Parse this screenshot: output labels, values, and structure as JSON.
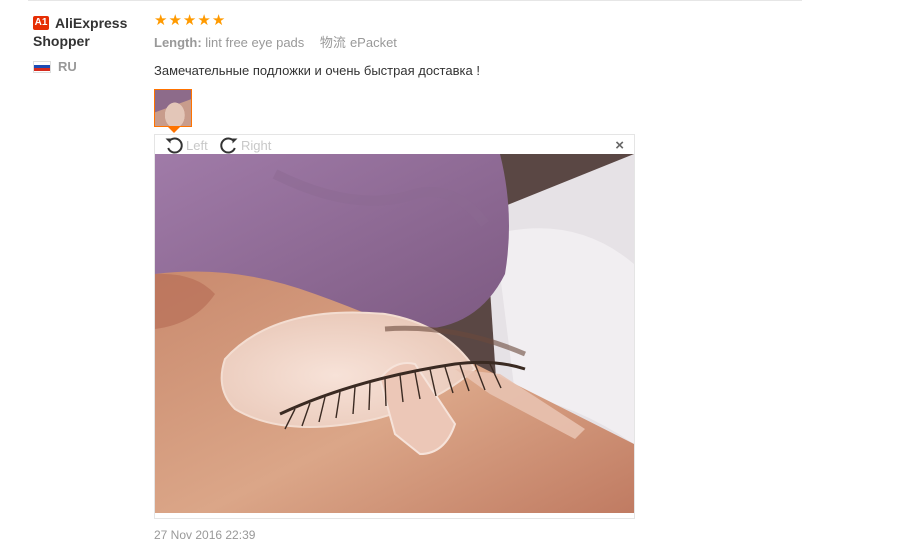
{
  "user": {
    "level_badge": "A1",
    "name_line1": "AliExpress",
    "name_line2": "Shopper",
    "country": "RU",
    "flag_colors": [
      "#ffffff",
      "#1c4bb4",
      "#d52b1e"
    ]
  },
  "feedback": {
    "rating_stars": 5,
    "star_color": "#ff9a00",
    "length_label": "Length:",
    "length_value": "lint free eye pads",
    "shipping_label": "物流",
    "shipping_value": "ePacket",
    "text": "Замечательные подложки и очень быстрая доставка !",
    "date": "27 Nov 2016 22:39"
  },
  "viewer": {
    "rotate_left_label": "Left",
    "rotate_right_label": "Right",
    "close_symbol": "×",
    "icons": {
      "rotate_left": "rotate-ccw-icon",
      "rotate_right": "rotate-cw-icon",
      "close": "close-icon"
    },
    "photo_alt": "Eyelash extension under-eye pad photo"
  },
  "colors": {
    "accent": "#ff7300",
    "badge": "#e62e04"
  }
}
